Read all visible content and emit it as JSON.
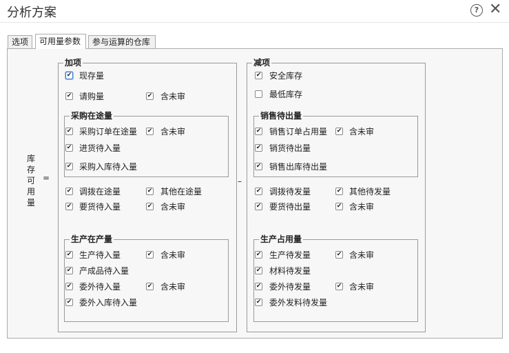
{
  "window": {
    "title": "分析方案"
  },
  "tabs": [
    {
      "label": "选项"
    },
    {
      "label": "可用量参数"
    },
    {
      "label": "参与运算的仓库"
    }
  ],
  "formula": {
    "left_label": "库存可用量",
    "left_label_chars": [
      "库",
      "存",
      "可",
      "用",
      "量"
    ],
    "equals": "=",
    "minus": "–"
  },
  "add": {
    "title": "加项",
    "xianchunliang": "现存量",
    "qinggouliang": "请购量",
    "hanweishen": "含未审",
    "purchase_transit": {
      "title": "采购在途量",
      "order_transit": "采购订单在途量",
      "order_unaudited": "含未审",
      "import_pending": "进货待入量",
      "purchase_in_pending": "采购入库待入量"
    },
    "transfer_transit": "调拨在途量",
    "other_transit": "其他在途量",
    "request_pending_in": "要货待入量",
    "request_unaudited": "含未审",
    "production": {
      "title": "生产在产量",
      "prod_pending_in": "生产待入量",
      "prod_unaudited": "含未审",
      "finished_pending_in": "产成品待入量",
      "outsource_pending_in": "委外待入量",
      "outsource_unaudited": "含未审",
      "outsource_store_pending": "委外入库待入量"
    }
  },
  "sub": {
    "title": "减项",
    "safety_stock": "安全库存",
    "min_stock": "最低库存",
    "sales_pending_out": {
      "title": "销售待出量",
      "order_occupied": "销售订单占用量",
      "order_unaudited": "含未审",
      "shipping_pending": "销货待出量",
      "sales_out_pending": "销售出库待出量"
    },
    "transfer_pending": "调拨待发量",
    "other_pending": "其他待发量",
    "request_pending_out": "要货待出量",
    "request_unaudited": "含未审",
    "production_use": {
      "title": "生产占用量",
      "prod_pending_issue": "生产待发量",
      "prod_unaudited": "含未审",
      "material_pending": "材料待发量",
      "outsource_pending_issue": "委外待发量",
      "outsource_unaudited": "含未审",
      "outsource_material_pending": "委外发料待发量"
    }
  },
  "checkbox_glyph": "✔"
}
